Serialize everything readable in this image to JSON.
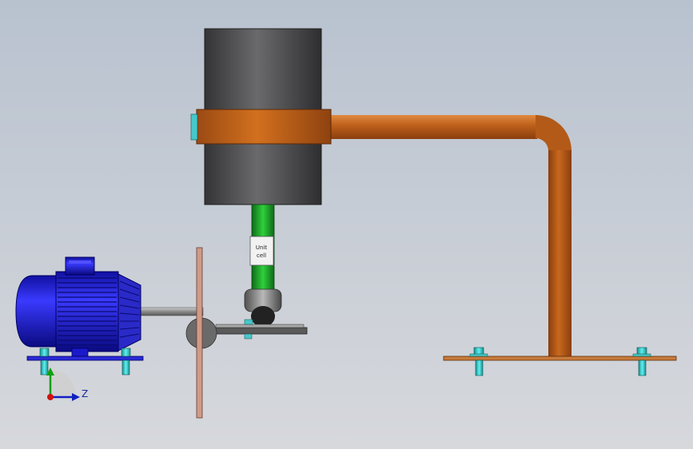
{
  "load_cell": {
    "line1": "Unit",
    "line2": "cell"
  },
  "axis": {
    "label": "Z"
  },
  "colors": {
    "background_top": "#b8c2cf",
    "background_bottom": "#d6d8dc",
    "cylinder": "#4a4a4c",
    "copper": "#c0621c",
    "motor_blue": "#1f1fd0",
    "shaft_green": "#1fa12c",
    "bolt_teal": "#2cc1c1",
    "plate": "#5a5a5a"
  }
}
